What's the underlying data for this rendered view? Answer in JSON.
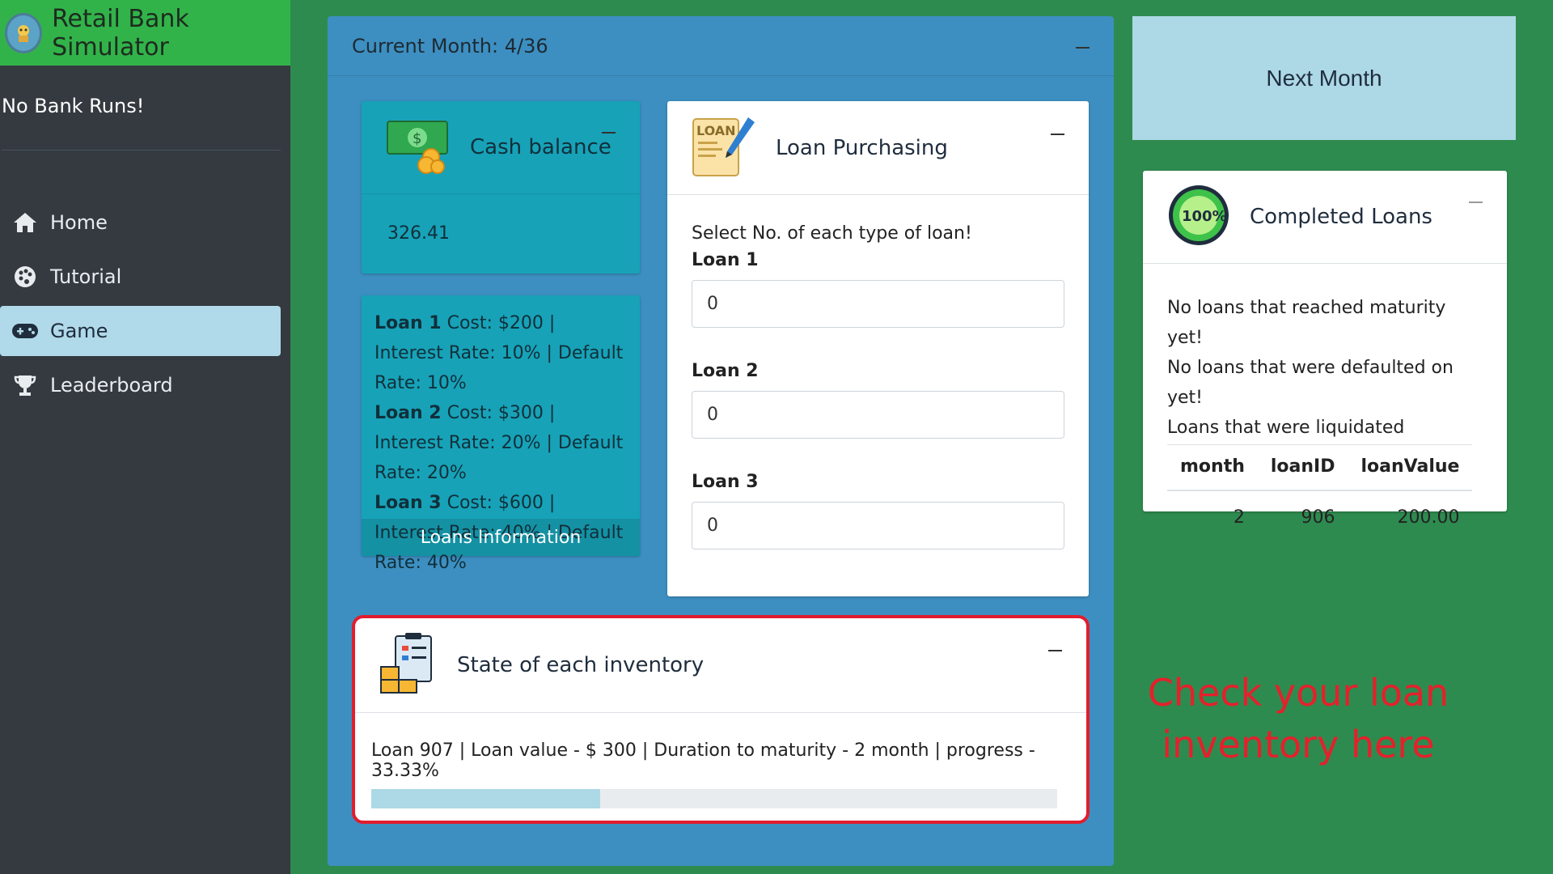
{
  "app": {
    "title": "Retail Bank Simulator",
    "tagline": "No Bank Runs!"
  },
  "nav": [
    {
      "label": "Home",
      "icon": "home-icon"
    },
    {
      "label": "Tutorial",
      "icon": "palette-icon"
    },
    {
      "label": "Game",
      "icon": "gamepad-icon",
      "active": true
    },
    {
      "label": "Leaderboard",
      "icon": "trophy-icon"
    }
  ],
  "main": {
    "header": "Current Month: 4/36"
  },
  "cash": {
    "title": "Cash balance",
    "value": "326.41",
    "icon": "money-icon"
  },
  "loans_info": {
    "lines": [
      {
        "name": "Loan 1",
        "text": " Cost: $200 | Interest Rate: 10% | Default Rate: 10%"
      },
      {
        "name": "Loan 2",
        "text": " Cost: $300 | Interest Rate: 20% | Default Rate: 20%"
      },
      {
        "name": "Loan 3",
        "text": " Cost: $600 | Interest Rate: 40% | Default Rate: 40%"
      }
    ],
    "footer": "Loans Information"
  },
  "purchasing": {
    "title": "Loan Purchasing",
    "icon": "loan-document-icon",
    "prompt": "Select No. of each type of loan!",
    "fields": [
      {
        "label": "Loan 1",
        "value": "0"
      },
      {
        "label": "Loan 2",
        "value": "0"
      },
      {
        "label": "Loan 3",
        "value": "0"
      }
    ]
  },
  "inventory": {
    "title": "State of each inventory",
    "icon": "inventory-clipboard-icon",
    "item": "Loan 907 | Loan value - $ 300 | Duration to maturity - 2 month | progress - 33.33%",
    "progress": 0.3333
  },
  "next_button": "Next Month",
  "completed": {
    "title": "Completed Loans",
    "icon": "100-percent-badge-icon",
    "lines": [
      "No loans that reached maturity yet!",
      "No loans that were defaulted on yet!",
      "Loans that were liquidated"
    ],
    "columns": [
      "month",
      "loanID",
      "loanValue"
    ],
    "rows": [
      [
        "2",
        "906",
        "200.00"
      ]
    ]
  },
  "annotation": "Check your loan inventory here",
  "colors": {
    "accent_green": "#32b34a",
    "panel_blue": "#3d8fc1",
    "teal": "#17a2b8",
    "highlight": "#e11d2e",
    "progress": "#add8e6"
  }
}
